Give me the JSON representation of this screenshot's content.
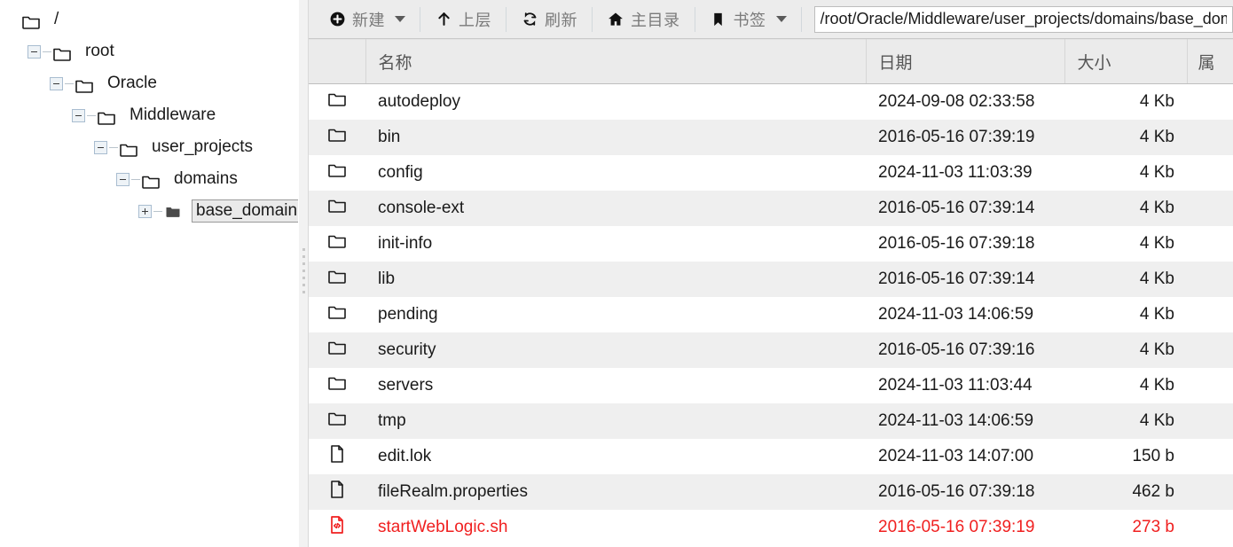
{
  "toolbar": {
    "buttons": [
      {
        "label": "新建",
        "icon": "plus-circle-icon",
        "has_caret": true
      },
      {
        "label": "上层",
        "icon": "arrow-up-icon",
        "has_caret": false
      },
      {
        "label": "刷新",
        "icon": "refresh-icon",
        "has_caret": false
      },
      {
        "label": "主目录",
        "icon": "home-icon",
        "has_caret": false
      },
      {
        "label": "书签",
        "icon": "bookmark-icon",
        "has_caret": true
      }
    ],
    "path": {
      "value": "/root/Oracle/Middleware/user_projects/domains/base_domain",
      "placeholder": "/"
    }
  },
  "tree": {
    "nodes": [
      {
        "label": "/",
        "depth": 0,
        "expander": "none",
        "icon": "folder-icon",
        "selected": false
      },
      {
        "label": "root",
        "depth": 1,
        "expander": "minus",
        "icon": "folder-icon",
        "selected": false
      },
      {
        "label": "Oracle",
        "depth": 2,
        "expander": "minus",
        "icon": "folder-icon",
        "selected": false
      },
      {
        "label": "Middleware",
        "depth": 3,
        "expander": "minus",
        "icon": "folder-icon",
        "selected": false
      },
      {
        "label": "user_projects",
        "depth": 4,
        "expander": "minus",
        "icon": "folder-icon",
        "selected": false
      },
      {
        "label": "domains",
        "depth": 5,
        "expander": "minus",
        "icon": "folder-icon",
        "selected": false
      },
      {
        "label": "base_domain",
        "depth": 6,
        "expander": "plus",
        "icon": "folder-filled-icon",
        "selected": true
      }
    ]
  },
  "table": {
    "columns": {
      "icon": "",
      "name": "名称",
      "date": "日期",
      "size": "大小",
      "attr": "属"
    },
    "rows": [
      {
        "icon": "folder-icon",
        "name": "autodeploy",
        "date": "2024-09-08 02:33:58",
        "size": "4 Kb",
        "attr": "",
        "flagged": false
      },
      {
        "icon": "folder-icon",
        "name": "bin",
        "date": "2016-05-16 07:39:19",
        "size": "4 Kb",
        "attr": "",
        "flagged": false
      },
      {
        "icon": "folder-icon",
        "name": "config",
        "date": "2024-11-03 11:03:39",
        "size": "4 Kb",
        "attr": "",
        "flagged": false
      },
      {
        "icon": "folder-icon",
        "name": "console-ext",
        "date": "2016-05-16 07:39:14",
        "size": "4 Kb",
        "attr": "",
        "flagged": false
      },
      {
        "icon": "folder-icon",
        "name": "init-info",
        "date": "2016-05-16 07:39:18",
        "size": "4 Kb",
        "attr": "",
        "flagged": false
      },
      {
        "icon": "folder-icon",
        "name": "lib",
        "date": "2016-05-16 07:39:14",
        "size": "4 Kb",
        "attr": "",
        "flagged": false
      },
      {
        "icon": "folder-icon",
        "name": "pending",
        "date": "2024-11-03 14:06:59",
        "size": "4 Kb",
        "attr": "",
        "flagged": false
      },
      {
        "icon": "folder-icon",
        "name": "security",
        "date": "2016-05-16 07:39:16",
        "size": "4 Kb",
        "attr": "",
        "flagged": false
      },
      {
        "icon": "folder-icon",
        "name": "servers",
        "date": "2024-11-03 11:03:44",
        "size": "4 Kb",
        "attr": "",
        "flagged": false
      },
      {
        "icon": "folder-icon",
        "name": "tmp",
        "date": "2024-11-03 14:06:59",
        "size": "4 Kb",
        "attr": "",
        "flagged": false
      },
      {
        "icon": "file-icon",
        "name": "edit.lok",
        "date": "2024-11-03 14:07:00",
        "size": "150 b",
        "attr": "",
        "flagged": false
      },
      {
        "icon": "file-icon",
        "name": "fileRealm.properties",
        "date": "2016-05-16 07:39:18",
        "size": "462 b",
        "attr": "",
        "flagged": false
      },
      {
        "icon": "script-icon",
        "name": "startWebLogic.sh",
        "date": "2016-05-16 07:39:19",
        "size": "273 b",
        "attr": "",
        "flagged": true
      }
    ]
  },
  "colors": {
    "flagged": "#f01f1f",
    "toolbar_bg": "#ececec",
    "header_bg": "#ebebeb",
    "row_alt_bg": "#efefef",
    "selection_bg": "#eaeaea"
  }
}
